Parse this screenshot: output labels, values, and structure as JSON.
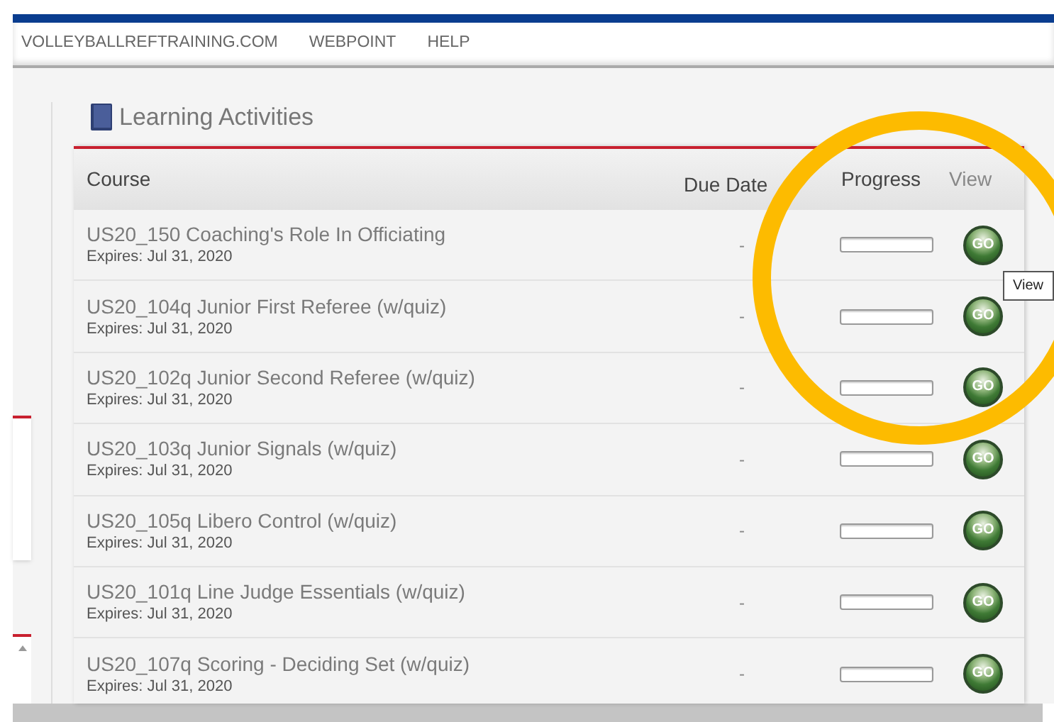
{
  "nav": [
    {
      "label": "VOLLEYBALLREFTRAINING.COM"
    },
    {
      "label": "WEBPOINT"
    },
    {
      "label": "HELP"
    }
  ],
  "section": {
    "title": "Learning Activities"
  },
  "table": {
    "columns": [
      "Course",
      "Due Date",
      "Progress",
      "View"
    ],
    "rows": [
      {
        "course": "US20_150 Coaching's Role In Officiating",
        "expires": "Expires: Jul 31, 2020",
        "due": "-",
        "level": 0,
        "action": "GO"
      },
      {
        "course": "US20_104q Junior First Referee (w/quiz)",
        "expires": "Expires: Jul 31, 2020",
        "due": "-",
        "level": 0,
        "action": "GO"
      },
      {
        "course": "US20_102q Junior Second Referee (w/quiz)",
        "expires": "Expires: Jul 31, 2020",
        "due": "-",
        "level": 0,
        "action": "GO"
      },
      {
        "course": "US20_103q Junior Signals (w/quiz)",
        "expires": "Expires: Jul 31, 2020",
        "due": "-",
        "level": 0,
        "action": "GO"
      },
      {
        "course": "US20_105q Libero Control (w/quiz)",
        "expires": "Expires: Jul 31, 2020",
        "due": "-",
        "level": 0,
        "action": "GO"
      },
      {
        "course": "US20_101q Line Judge Essentials (w/quiz)",
        "expires": "Expires: Jul 31, 2020",
        "due": "-",
        "level": 0,
        "action": "GO"
      },
      {
        "course": "US20_107q Scoring - Deciding Set (w/quiz)",
        "expires": "Expires: Jul 31, 2020",
        "due": "-",
        "level": 0,
        "action": "GO"
      }
    ]
  },
  "tooltip": {
    "text": "View"
  }
}
